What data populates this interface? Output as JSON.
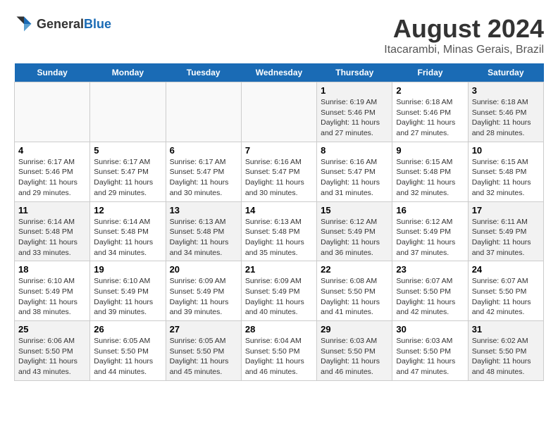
{
  "header": {
    "logo_general": "General",
    "logo_blue": "Blue",
    "main_title": "August 2024",
    "subtitle": "Itacarambi, Minas Gerais, Brazil"
  },
  "days_of_week": [
    "Sunday",
    "Monday",
    "Tuesday",
    "Wednesday",
    "Thursday",
    "Friday",
    "Saturday"
  ],
  "weeks": [
    [
      {
        "day": "",
        "detail": "",
        "empty": true
      },
      {
        "day": "",
        "detail": "",
        "empty": true
      },
      {
        "day": "",
        "detail": "",
        "empty": true
      },
      {
        "day": "",
        "detail": "",
        "empty": true
      },
      {
        "day": "1",
        "detail": "Sunrise: 6:19 AM\nSunset: 5:46 PM\nDaylight: 11 hours\nand 27 minutes."
      },
      {
        "day": "2",
        "detail": "Sunrise: 6:18 AM\nSunset: 5:46 PM\nDaylight: 11 hours\nand 27 minutes."
      },
      {
        "day": "3",
        "detail": "Sunrise: 6:18 AM\nSunset: 5:46 PM\nDaylight: 11 hours\nand 28 minutes."
      }
    ],
    [
      {
        "day": "4",
        "detail": "Sunrise: 6:17 AM\nSunset: 5:46 PM\nDaylight: 11 hours\nand 29 minutes."
      },
      {
        "day": "5",
        "detail": "Sunrise: 6:17 AM\nSunset: 5:47 PM\nDaylight: 11 hours\nand 29 minutes."
      },
      {
        "day": "6",
        "detail": "Sunrise: 6:17 AM\nSunset: 5:47 PM\nDaylight: 11 hours\nand 30 minutes."
      },
      {
        "day": "7",
        "detail": "Sunrise: 6:16 AM\nSunset: 5:47 PM\nDaylight: 11 hours\nand 30 minutes."
      },
      {
        "day": "8",
        "detail": "Sunrise: 6:16 AM\nSunset: 5:47 PM\nDaylight: 11 hours\nand 31 minutes."
      },
      {
        "day": "9",
        "detail": "Sunrise: 6:15 AM\nSunset: 5:48 PM\nDaylight: 11 hours\nand 32 minutes."
      },
      {
        "day": "10",
        "detail": "Sunrise: 6:15 AM\nSunset: 5:48 PM\nDaylight: 11 hours\nand 32 minutes."
      }
    ],
    [
      {
        "day": "11",
        "detail": "Sunrise: 6:14 AM\nSunset: 5:48 PM\nDaylight: 11 hours\nand 33 minutes."
      },
      {
        "day": "12",
        "detail": "Sunrise: 6:14 AM\nSunset: 5:48 PM\nDaylight: 11 hours\nand 34 minutes."
      },
      {
        "day": "13",
        "detail": "Sunrise: 6:13 AM\nSunset: 5:48 PM\nDaylight: 11 hours\nand 34 minutes."
      },
      {
        "day": "14",
        "detail": "Sunrise: 6:13 AM\nSunset: 5:48 PM\nDaylight: 11 hours\nand 35 minutes."
      },
      {
        "day": "15",
        "detail": "Sunrise: 6:12 AM\nSunset: 5:49 PM\nDaylight: 11 hours\nand 36 minutes."
      },
      {
        "day": "16",
        "detail": "Sunrise: 6:12 AM\nSunset: 5:49 PM\nDaylight: 11 hours\nand 37 minutes."
      },
      {
        "day": "17",
        "detail": "Sunrise: 6:11 AM\nSunset: 5:49 PM\nDaylight: 11 hours\nand 37 minutes."
      }
    ],
    [
      {
        "day": "18",
        "detail": "Sunrise: 6:10 AM\nSunset: 5:49 PM\nDaylight: 11 hours\nand 38 minutes."
      },
      {
        "day": "19",
        "detail": "Sunrise: 6:10 AM\nSunset: 5:49 PM\nDaylight: 11 hours\nand 39 minutes."
      },
      {
        "day": "20",
        "detail": "Sunrise: 6:09 AM\nSunset: 5:49 PM\nDaylight: 11 hours\nand 39 minutes."
      },
      {
        "day": "21",
        "detail": "Sunrise: 6:09 AM\nSunset: 5:49 PM\nDaylight: 11 hours\nand 40 minutes."
      },
      {
        "day": "22",
        "detail": "Sunrise: 6:08 AM\nSunset: 5:50 PM\nDaylight: 11 hours\nand 41 minutes."
      },
      {
        "day": "23",
        "detail": "Sunrise: 6:07 AM\nSunset: 5:50 PM\nDaylight: 11 hours\nand 42 minutes."
      },
      {
        "day": "24",
        "detail": "Sunrise: 6:07 AM\nSunset: 5:50 PM\nDaylight: 11 hours\nand 42 minutes."
      }
    ],
    [
      {
        "day": "25",
        "detail": "Sunrise: 6:06 AM\nSunset: 5:50 PM\nDaylight: 11 hours\nand 43 minutes."
      },
      {
        "day": "26",
        "detail": "Sunrise: 6:05 AM\nSunset: 5:50 PM\nDaylight: 11 hours\nand 44 minutes."
      },
      {
        "day": "27",
        "detail": "Sunrise: 6:05 AM\nSunset: 5:50 PM\nDaylight: 11 hours\nand 45 minutes."
      },
      {
        "day": "28",
        "detail": "Sunrise: 6:04 AM\nSunset: 5:50 PM\nDaylight: 11 hours\nand 46 minutes."
      },
      {
        "day": "29",
        "detail": "Sunrise: 6:03 AM\nSunset: 5:50 PM\nDaylight: 11 hours\nand 46 minutes."
      },
      {
        "day": "30",
        "detail": "Sunrise: 6:03 AM\nSunset: 5:50 PM\nDaylight: 11 hours\nand 47 minutes."
      },
      {
        "day": "31",
        "detail": "Sunrise: 6:02 AM\nSunset: 5:50 PM\nDaylight: 11 hours\nand 48 minutes."
      }
    ]
  ]
}
